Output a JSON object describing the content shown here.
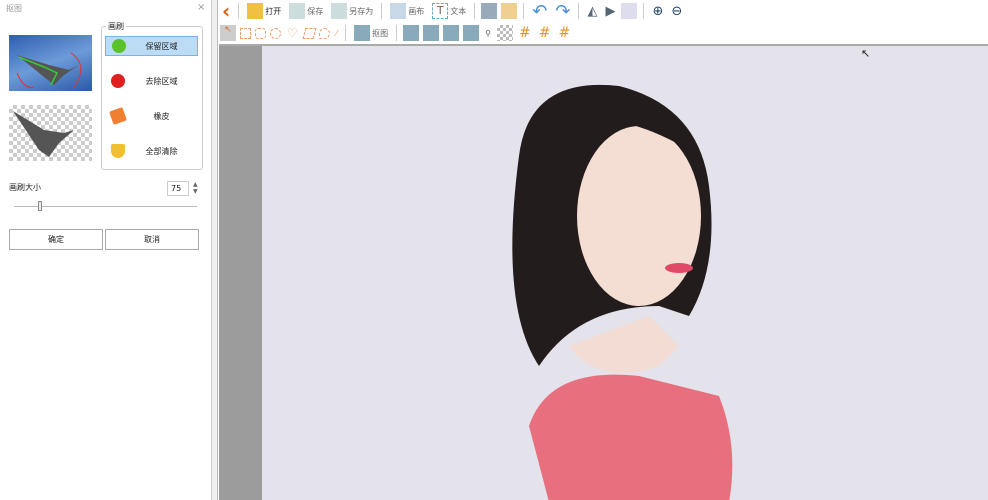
{
  "panel": {
    "title": "抠图",
    "close": "×",
    "brush_group": "画刷",
    "tools": [
      {
        "label": "保留区域",
        "color": "#5cc22a"
      },
      {
        "label": "去除区域",
        "color": "#e02020"
      },
      {
        "label": "橡皮",
        "color": "#f08030"
      },
      {
        "label": "全部清除",
        "color": "#f0c030"
      }
    ],
    "brush_size_label": "画刷大小",
    "brush_size": "75",
    "brush_fraction": 0.13,
    "ok": "确定",
    "cancel": "取消"
  },
  "toolbar": {
    "back": "‹",
    "open": "打开",
    "save": "保存",
    "save_as": "另存为",
    "canvas": "画布",
    "text": "文本",
    "cutout": "抠图"
  }
}
